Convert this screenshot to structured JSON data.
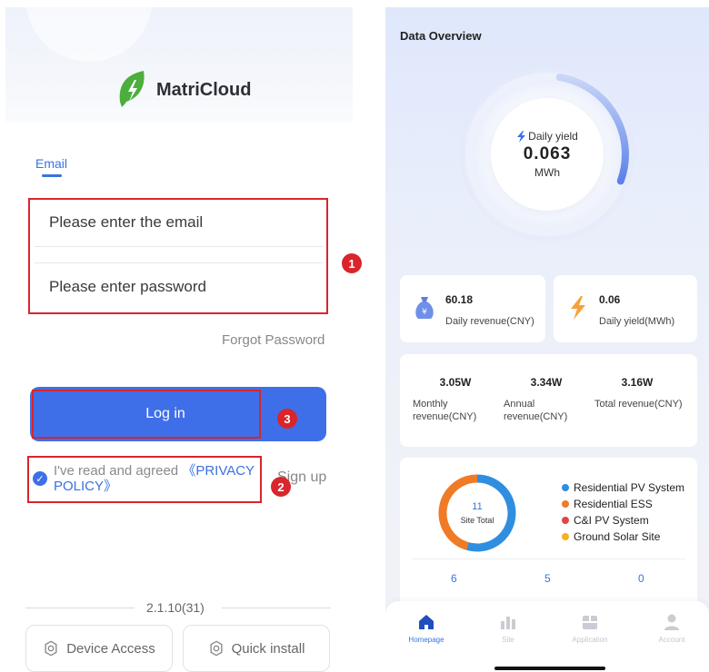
{
  "login": {
    "brand_name": "MatriCloud",
    "tab_email": "Email",
    "email_placeholder": "Please enter the email",
    "password_placeholder": "Please enter password",
    "forgot_password": "Forgot Password",
    "login_button": "Log in",
    "agree_text": "I've read and agreed ",
    "privacy_policy": "《PRIVACY POLICY》",
    "sign_up": "Sign up",
    "version": "2.1.10(31)",
    "device_access": "Device Access",
    "quick_install": "Quick install",
    "annotations": [
      "1",
      "2",
      "3"
    ],
    "brand_color": "#3f6fe8",
    "annotation_color": "#d9252b"
  },
  "dashboard": {
    "title": "Data Overview",
    "gauge": {
      "label": "Daily yield",
      "value": "0.063",
      "unit": "MWh",
      "progress_fraction": 0.28
    },
    "revenue_card": {
      "value": "60.18",
      "label": "Daily revenue(CNY)"
    },
    "yield_card": {
      "value": "0.06",
      "label": "Daily yield(MWh)"
    },
    "revenues": [
      {
        "value": "3.05W",
        "label": "Monthly revenue(CNY)"
      },
      {
        "value": "3.34W",
        "label": "Annual revenue(CNY)"
      },
      {
        "value": "3.16W",
        "label": "Total revenue(CNY)"
      }
    ],
    "sites": {
      "total": "11",
      "total_label": "Site Total",
      "legend": [
        {
          "name": "Residential PV System",
          "color": "#2f8ee0"
        },
        {
          "name": "Residential ESS",
          "color": "#f07a25"
        },
        {
          "name": "C&I PV System",
          "color": "#e04545"
        },
        {
          "name": "Ground Solar Site",
          "color": "#f5b01c"
        }
      ],
      "donut_segments": [
        {
          "name": "Residential PV System",
          "value": 6,
          "color": "#2f8ee0"
        },
        {
          "name": "Residential ESS",
          "value": 5,
          "color": "#f07a25"
        }
      ],
      "counts": [
        "6",
        "5",
        "0"
      ]
    },
    "tabs": [
      {
        "label": "Homepage",
        "icon": "home-icon",
        "active": true
      },
      {
        "label": "Site",
        "icon": "site-icon",
        "active": false
      },
      {
        "label": "Application",
        "icon": "application-icon",
        "active": false
      },
      {
        "label": "Account",
        "icon": "account-icon",
        "active": false
      }
    ]
  }
}
